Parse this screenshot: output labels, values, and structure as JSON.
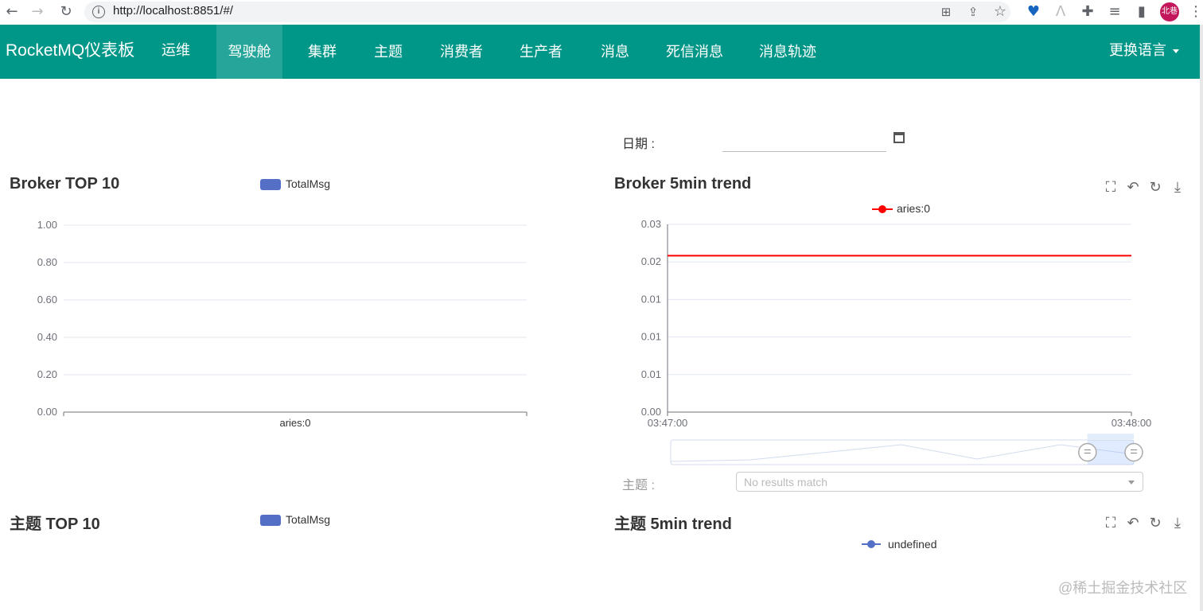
{
  "browser": {
    "url_prefix": "http://",
    "url_host": "localhost",
    "url_rest": ":8851/#/",
    "profile_label": "北巷"
  },
  "navbar": {
    "brand": "RocketMQ仪表板",
    "items": [
      {
        "label": "运维"
      },
      {
        "label": "驾驶舱",
        "active": true
      },
      {
        "label": "集群"
      },
      {
        "label": "主题"
      },
      {
        "label": "消费者"
      },
      {
        "label": "生产者"
      },
      {
        "label": "消息"
      },
      {
        "label": "死信消息"
      },
      {
        "label": "消息轨迹"
      }
    ],
    "language": "更换语言",
    "color": "#009688",
    "active_color": "#26a69a"
  },
  "date": {
    "label": "日期 :",
    "value": ""
  },
  "topic_filter": {
    "label": "主题 :",
    "placeholder": "No results match"
  },
  "watermark": "@稀土掘金技术社区",
  "chart_data": [
    {
      "type": "bar",
      "title": "Broker TOP 10",
      "legend": [
        "TotalMsg"
      ],
      "categories": [
        "aries:0"
      ],
      "series": [
        {
          "name": "TotalMsg",
          "values": [
            0
          ]
        }
      ],
      "ylim": [
        0,
        1
      ],
      "yticks": [
        "0.00",
        "0.20",
        "0.40",
        "0.60",
        "0.80",
        "1.00"
      ],
      "grid": true,
      "color": "#5470c6"
    },
    {
      "type": "line",
      "title": "Broker 5min trend",
      "legend": [
        "aries:0"
      ],
      "x": [
        "03:47:00",
        "03:48:00"
      ],
      "series": [
        {
          "name": "aries:0",
          "values": [
            0.025,
            0.025
          ]
        }
      ],
      "ylim": [
        0,
        0.03
      ],
      "yticks": [
        "0.00",
        "0.01",
        "0.01",
        "0.01",
        "0.02",
        "0.03"
      ],
      "grid": true,
      "color": "#ff0000",
      "toolbox": [
        "zoom-icon",
        "zoom-reset-icon",
        "restore-icon",
        "download-icon"
      ],
      "datazoom": {
        "start_fraction": 0.9,
        "end_fraction": 1.0
      }
    },
    {
      "type": "bar",
      "title": "主题 TOP 10",
      "legend": [
        "TotalMsg"
      ],
      "series": [
        {
          "name": "TotalMsg",
          "values": []
        }
      ],
      "color": "#5470c6"
    },
    {
      "type": "line",
      "title": "主题 5min trend",
      "legend": [
        "undefined"
      ],
      "series": [
        {
          "name": "undefined",
          "values": []
        }
      ],
      "color": "#5470c6",
      "toolbox": [
        "zoom-icon",
        "zoom-reset-icon",
        "restore-icon",
        "download-icon"
      ]
    }
  ]
}
